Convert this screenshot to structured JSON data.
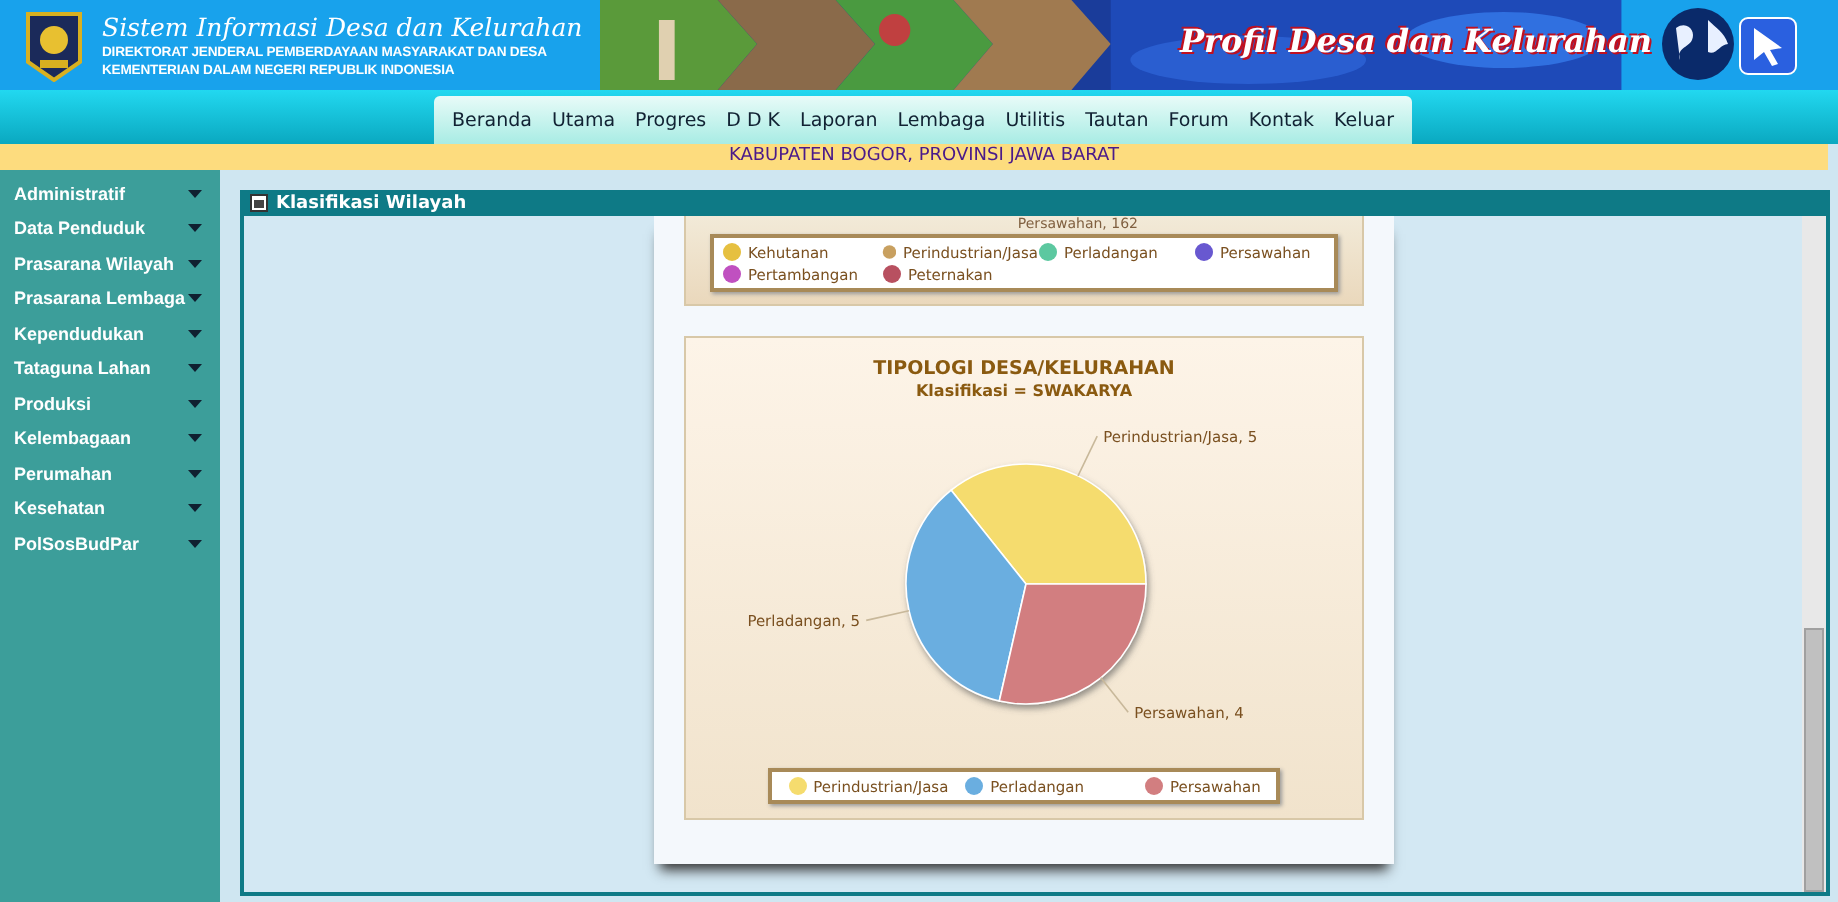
{
  "header": {
    "title": "Sistem Informasi Desa dan Kelurahan",
    "subtitle_lines": [
      "DIREKTORAT JENDERAL PEMBERDAYAAN MASYARAKAT DAN DESA",
      "KEMENTERIAN DALAM NEGERI REPUBLIK INDONESIA"
    ],
    "banner_title": "Profil Desa dan Kelurahan"
  },
  "nav": [
    "Beranda",
    "Utama",
    "Progres",
    "D D K",
    "Laporan",
    "Lembaga",
    "Utilitis",
    "Tautan",
    "Forum",
    "Kontak",
    "Keluar"
  ],
  "region": "KABUPATEN BOGOR, PROVINSI JAWA BARAT",
  "sidebar": {
    "items": [
      "Administratif",
      "Data Penduduk",
      "Prasarana Wilayah",
      "Prasarana Lembaga",
      "Kependudukan",
      "Tataguna Lahan",
      "Produksi",
      "Kelembagaan",
      "Perumahan",
      "Kesehatan",
      "PolSosBudPar"
    ]
  },
  "panel": {
    "title": "Klasifikasi Wilayah",
    "previous_chart": {
      "slice_label": "Persawahan, 162",
      "legend": [
        {
          "label": "Kehutanan",
          "color": "#e6c040"
        },
        {
          "label": "Perindustrian/Jasa",
          "color": "#c8a060"
        },
        {
          "label": "Perladangan",
          "color": "#5cc8a0"
        },
        {
          "label": "Persawahan",
          "color": "#6858d0"
        },
        {
          "label": "Pertambangan",
          "color": "#c050c0"
        },
        {
          "label": "Peternakan",
          "color": "#b85060"
        }
      ]
    },
    "chart": {
      "subtitle": "Klasifikasi = SWAKARYA",
      "legend": [
        {
          "label": "Perindustrian/Jasa",
          "color": "#f5dc6e"
        },
        {
          "label": "Perladangan",
          "color": "#6aaee0"
        },
        {
          "label": "Persawahan",
          "color": "#d27e80"
        }
      ],
      "chart_data": {
        "type": "pie",
        "title": "TIPOLOGI DESA/KELURAHAN",
        "values": [
          5,
          5,
          4
        ],
        "value_labels": [
          "Perindustrian/Jasa, 5",
          "Perladangan, 5",
          "Persawahan, 4"
        ]
      }
    }
  }
}
